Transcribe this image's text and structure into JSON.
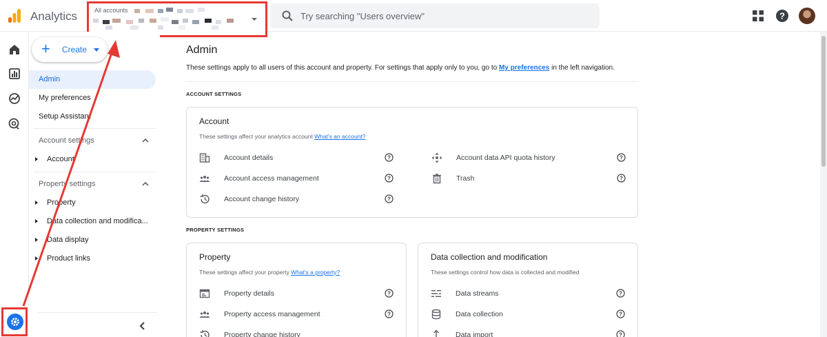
{
  "app": {
    "title": "Analytics"
  },
  "account_picker": {
    "label": "All accounts"
  },
  "search": {
    "placeholder": "Try searching \"Users overview\""
  },
  "sidebar": {
    "create_label": "Create",
    "items": [
      {
        "label": "Admin"
      },
      {
        "label": "My preferences"
      },
      {
        "label": "Setup Assistant"
      }
    ],
    "account_section": {
      "title": "Account settings",
      "children": [
        {
          "label": "Account"
        }
      ]
    },
    "property_section": {
      "title": "Property settings",
      "children": [
        {
          "label": "Property"
        },
        {
          "label": "Data collection and modifica..."
        },
        {
          "label": "Data display"
        },
        {
          "label": "Product links"
        }
      ]
    }
  },
  "main": {
    "title": "Admin",
    "intro_before": "These settings apply to all users of this account and property. For settings that apply only to you, go to ",
    "intro_link": "My preferences",
    "intro_after": " in the left navigation.",
    "account_heading": "ACCOUNT SETTINGS",
    "property_heading": "PROPERTY SETTINGS",
    "account_card": {
      "title": "Account",
      "desc": "These settings affect your analytics account ",
      "desc_link": "What's an account?",
      "left_rows": [
        {
          "label": "Account details",
          "icon": "building-icon"
        },
        {
          "label": "Account access management",
          "icon": "people-icon"
        },
        {
          "label": "Account change history",
          "icon": "history-icon"
        }
      ],
      "right_rows": [
        {
          "label": "Account data API quota history",
          "icon": "move-arrows-icon"
        },
        {
          "label": "Trash",
          "icon": "trash-icon"
        }
      ]
    },
    "property_card": {
      "title": "Property",
      "desc": "These settings affect your property ",
      "desc_link": "What's a property?",
      "rows": [
        {
          "label": "Property details",
          "icon": "window-icon"
        },
        {
          "label": "Property access management",
          "icon": "people-icon"
        },
        {
          "label": "Property change history",
          "icon": "history-icon"
        }
      ]
    },
    "data_card": {
      "title": "Data collection and modification",
      "desc": "These settings control how data is collected and modified",
      "rows": [
        {
          "label": "Data streams",
          "icon": "streams-icon"
        },
        {
          "label": "Data collection",
          "icon": "database-icon"
        },
        {
          "label": "Data import",
          "icon": "upload-icon"
        }
      ]
    }
  },
  "colors": {
    "accent": "#1a73e8",
    "annotation": "#e53935",
    "logo_orange": "#f9ab00",
    "logo_dark": "#e37400"
  }
}
